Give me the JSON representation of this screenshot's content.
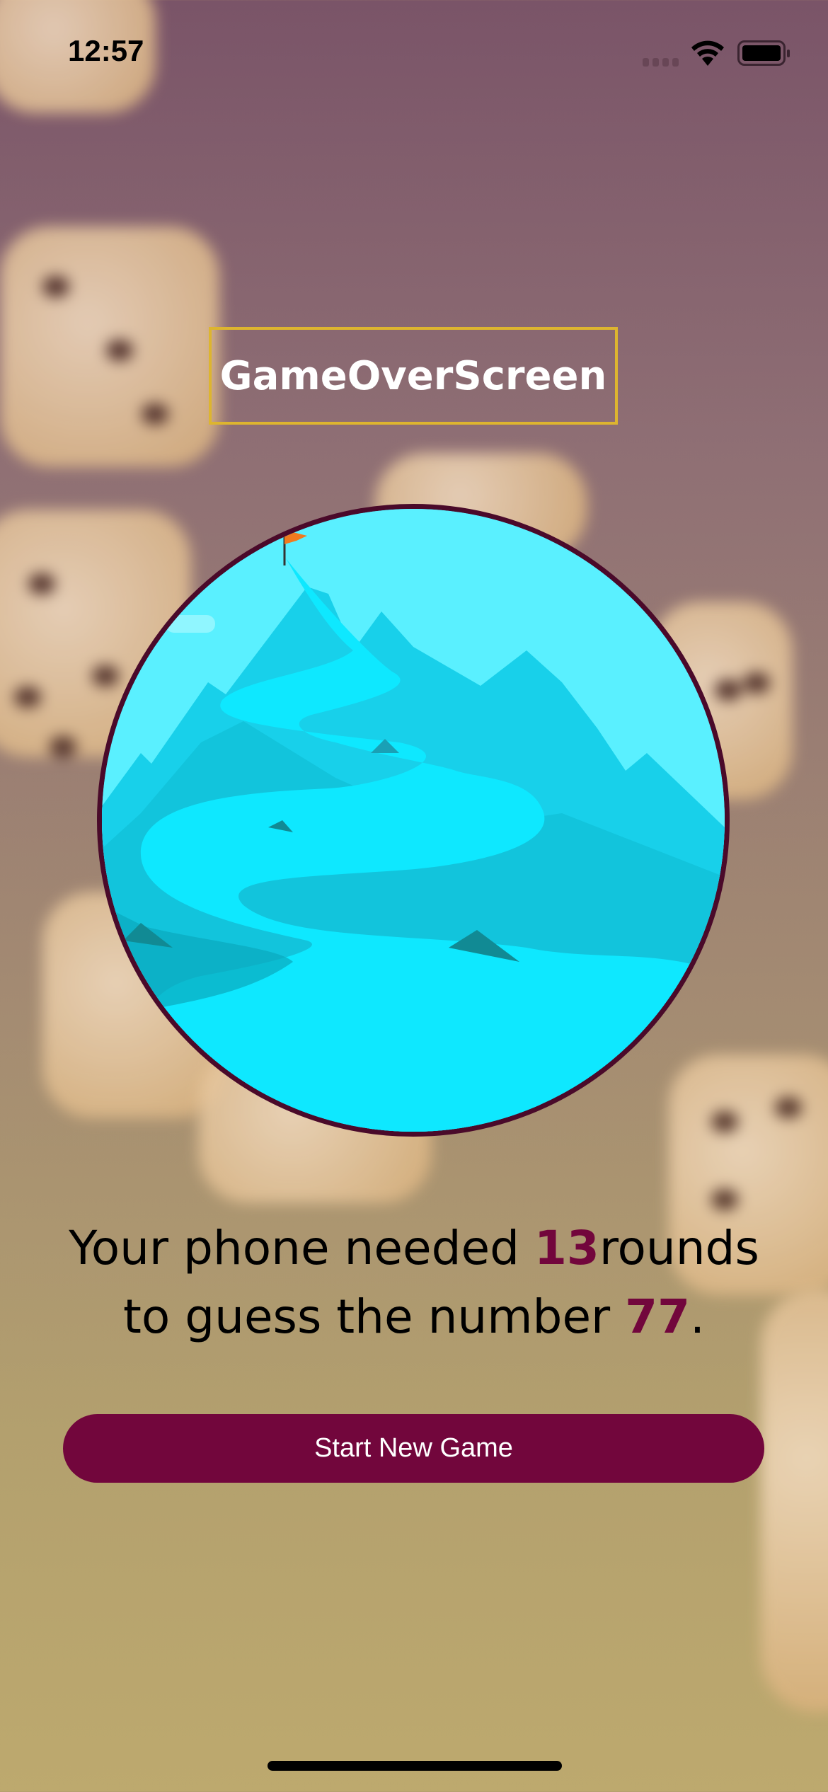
{
  "status_bar": {
    "time": "12:57"
  },
  "screen": {
    "title": "GameOverScreen"
  },
  "summary": {
    "prefix": "Your phone needed ",
    "rounds": "13",
    "middle": "rounds",
    "line2": "to guess the number ",
    "number": "77",
    "suffix": "."
  },
  "actions": {
    "start_new_game": "Start New Game"
  },
  "colors": {
    "accent": "#72063c",
    "title_border": "#ddb52f",
    "circle_border": "#4a0a2a"
  }
}
